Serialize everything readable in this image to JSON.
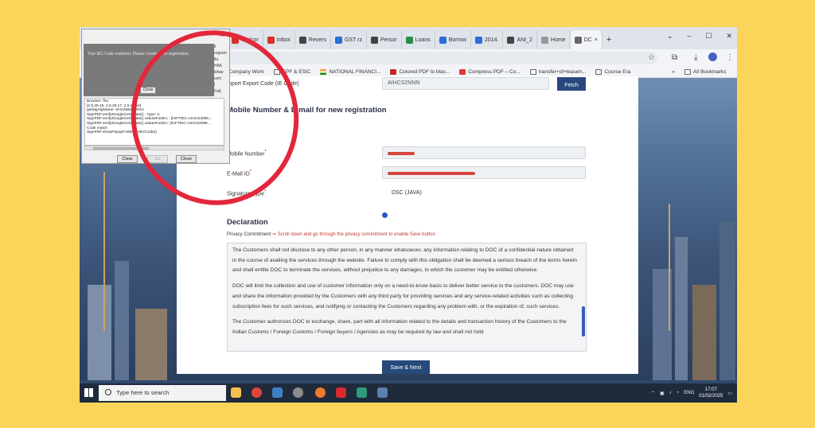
{
  "browser": {
    "tabs": [
      {
        "label": "Welcor",
        "color": "#d93025"
      },
      {
        "label": "Inbox",
        "color": "#d93025"
      },
      {
        "label": "Revers",
        "color": "#444444"
      },
      {
        "label": "GST rz",
        "color": "#2a6fd6"
      },
      {
        "label": "Persor",
        "color": "#444444"
      },
      {
        "label": "Loans",
        "color": "#2d8a4e"
      },
      {
        "label": "Borrow",
        "color": "#2a6fd6"
      },
      {
        "label": "2014.",
        "color": "#2a6fd6"
      },
      {
        "label": "ANI_2",
        "color": "#444444"
      },
      {
        "label": "Home",
        "color": "#444444"
      },
      {
        "label": "DC",
        "color": "#444444"
      }
    ],
    "new_tab": "+",
    "url": "t",
    "bookmarks": [
      "Company Work",
      "EPF & ESIC",
      "NATIONAL FINANCI...",
      "Colored PDF to blac...",
      "Compress PDF – Co...",
      "transfer+of+leaseh...",
      "Course Era"
    ],
    "more": "»",
    "all_bookmarks": "All Bookmarks"
  },
  "form": {
    "iec_label": "mport Export Code (IE Code)",
    "iec_value": "AIHCS2NNN",
    "fetch_label": "Fetch",
    "section_title": "Mobile Number & E-mail for new registration",
    "mobile_label": "Mobile Number",
    "email_label": "E-Mail ID",
    "signature_label": "Signature Type",
    "signature_option": "DSC (JAVA)",
    "required_mark": "*"
  },
  "declaration": {
    "title": "Declaration",
    "privacy_label": "Privacy Commitment",
    "privacy_arrow": "➞",
    "privacy_note": "Scroll down and go through the privacy commitment to enable Save button",
    "paragraphs": [
      "The Customers shall not disclose to any other person, in any manner whatsoever, any information relating to DOC of a confidential nature obtained in the course of availing the services through the website. Failure to comply with this obligation shall be deemed a serious breach of the terms herein and shall entitle DOC to terminate the services, without prejudice to any damages, to which the customer may be entitled otherwise.",
      "DOC will limit the collection and use of customer information only on a need-to-know basis to deliver better service to the customers. DOC may use and share the information provided by the Customers with any third party for providing services and any service-related activities such as collecting subscription fees for such services, and notifying or contacting the Customers regarding any problem with, or the expiration of, such services.",
      "The Customer authorizes DOC to exchange, share, part with all information related to the details and transaction history of the Customers to the Indian Customs / Foreign Customs / Foreign buyers / Agencies as may be required by law and shall not hold"
    ],
    "save_label": "Save & Next"
  },
  "popup": {
    "message": "Your IEC Code matched. Please Continue for registration.",
    "message_close": "Close",
    "side_text": [
      "ll",
      "rogram",
      "lla",
      "HAK",
      "lefaw",
      "cert:",
      "l",
      "Fall,",
      "lle"
    ],
    "log_lines": [
      "Browser: fha",
      "[2.5.29.15, 2.5.29.17, 2.5.29.19]",
      "getSigAlgName: SHA256withRSA",
      "SignPDF.verifyDongleCertificate() : Type: C",
      "SignPDF.verifyDongleCertificate() valuesForIEC : [IGFTIEC-AIHCS209K...",
      "SignPDF.verifyDongleCertificate() valuesForIEC: [IGFTIEC-AIHCS209K...",
      "Code match",
      "SignPDF.showPopupForMatchIECCode()"
    ],
    "clear_label": "Clear",
    "middle_label": "Co",
    "close_label": "Close",
    "x_label": "×"
  },
  "taskbar": {
    "search_placeholder": "Type here to search",
    "language": "ENG",
    "time": "17:07",
    "date": "01/02/2025"
  },
  "colors": {
    "accent": "#27497c",
    "annotation": "#e3273b",
    "backdrop": "#fbd55a"
  }
}
